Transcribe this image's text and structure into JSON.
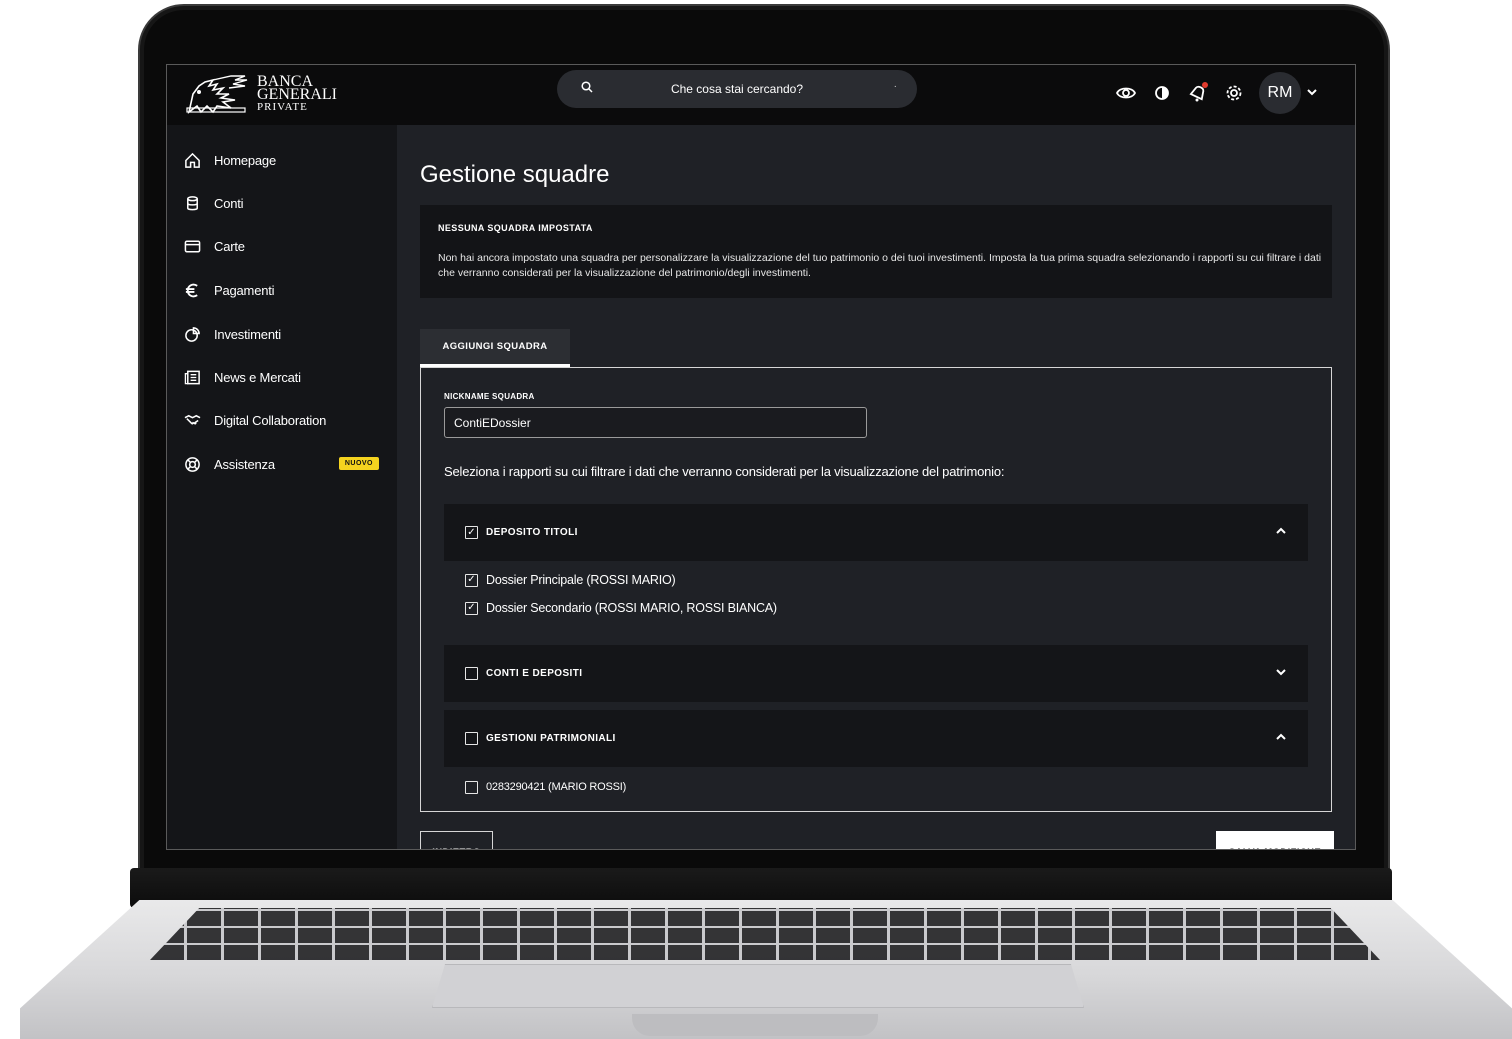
{
  "brand": {
    "line1": "BANCA",
    "line2": "GENERALI",
    "line3": "PRIVATE"
  },
  "search": {
    "placeholder": "Che cosa stai cercando?"
  },
  "header": {
    "avatar_initials": "RM"
  },
  "sidebar": {
    "items": [
      {
        "label": "Homepage",
        "icon": "home-icon"
      },
      {
        "label": "Conti",
        "icon": "database-icon"
      },
      {
        "label": "Carte",
        "icon": "card-icon"
      },
      {
        "label": "Pagamenti",
        "icon": "euro-icon"
      },
      {
        "label": "Investimenti",
        "icon": "pie-chart-icon"
      },
      {
        "label": "News e Mercati",
        "icon": "newspaper-icon"
      },
      {
        "label": "Digital Collaboration",
        "icon": "handshake-icon"
      },
      {
        "label": "Assistenza",
        "icon": "lifebuoy-icon",
        "badge": "NUOVO"
      }
    ]
  },
  "main": {
    "title": "Gestione squadre",
    "notice": {
      "title": "NESSUNA SQUADRA IMPOSTATA",
      "text": "Non hai ancora impostato una squadra per personalizzare la visualizzazione del tuo patrimonio o dei tuoi investimenti. Imposta la tua prima squadra selezionando i rapporti su cui filtrare i dati che verranno considerati per la visualizzazione del patrimonio/degli investimenti."
    },
    "tab_label": "AGGIUNGI SQUADRA",
    "form": {
      "nickname_label": "NICKNAME SQUADRA",
      "nickname_value": "ContiEDossier",
      "select_hint": "Seleziona i rapporti su cui filtrare i dati che verranno considerati per la visualizzazione del patrimonio:",
      "groups": [
        {
          "label": "DEPOSITO TITOLI",
          "checked": true,
          "expanded": true,
          "items": [
            {
              "label": "Dossier Principale (ROSSI MARIO)",
              "checked": true
            },
            {
              "label": "Dossier Secondario (ROSSI MARIO, ROSSI BIANCA)",
              "checked": true
            }
          ]
        },
        {
          "label": "CONTI E DEPOSITI",
          "checked": false,
          "expanded": false,
          "items": []
        },
        {
          "label": "GESTIONI PATRIMONIALI",
          "checked": false,
          "expanded": true,
          "items": [
            {
              "label": "0283290421  (MARIO ROSSI)",
              "checked": false
            }
          ]
        }
      ]
    },
    "buttons": {
      "back": "INDIETRO",
      "save": "SALVA MODIFICHE"
    }
  },
  "colors": {
    "topbar": "#0b0b0c",
    "sidebar": "#141518",
    "content": "#1f2126",
    "badge": "#f5d31f",
    "notification_dot": "#e23b2e"
  }
}
